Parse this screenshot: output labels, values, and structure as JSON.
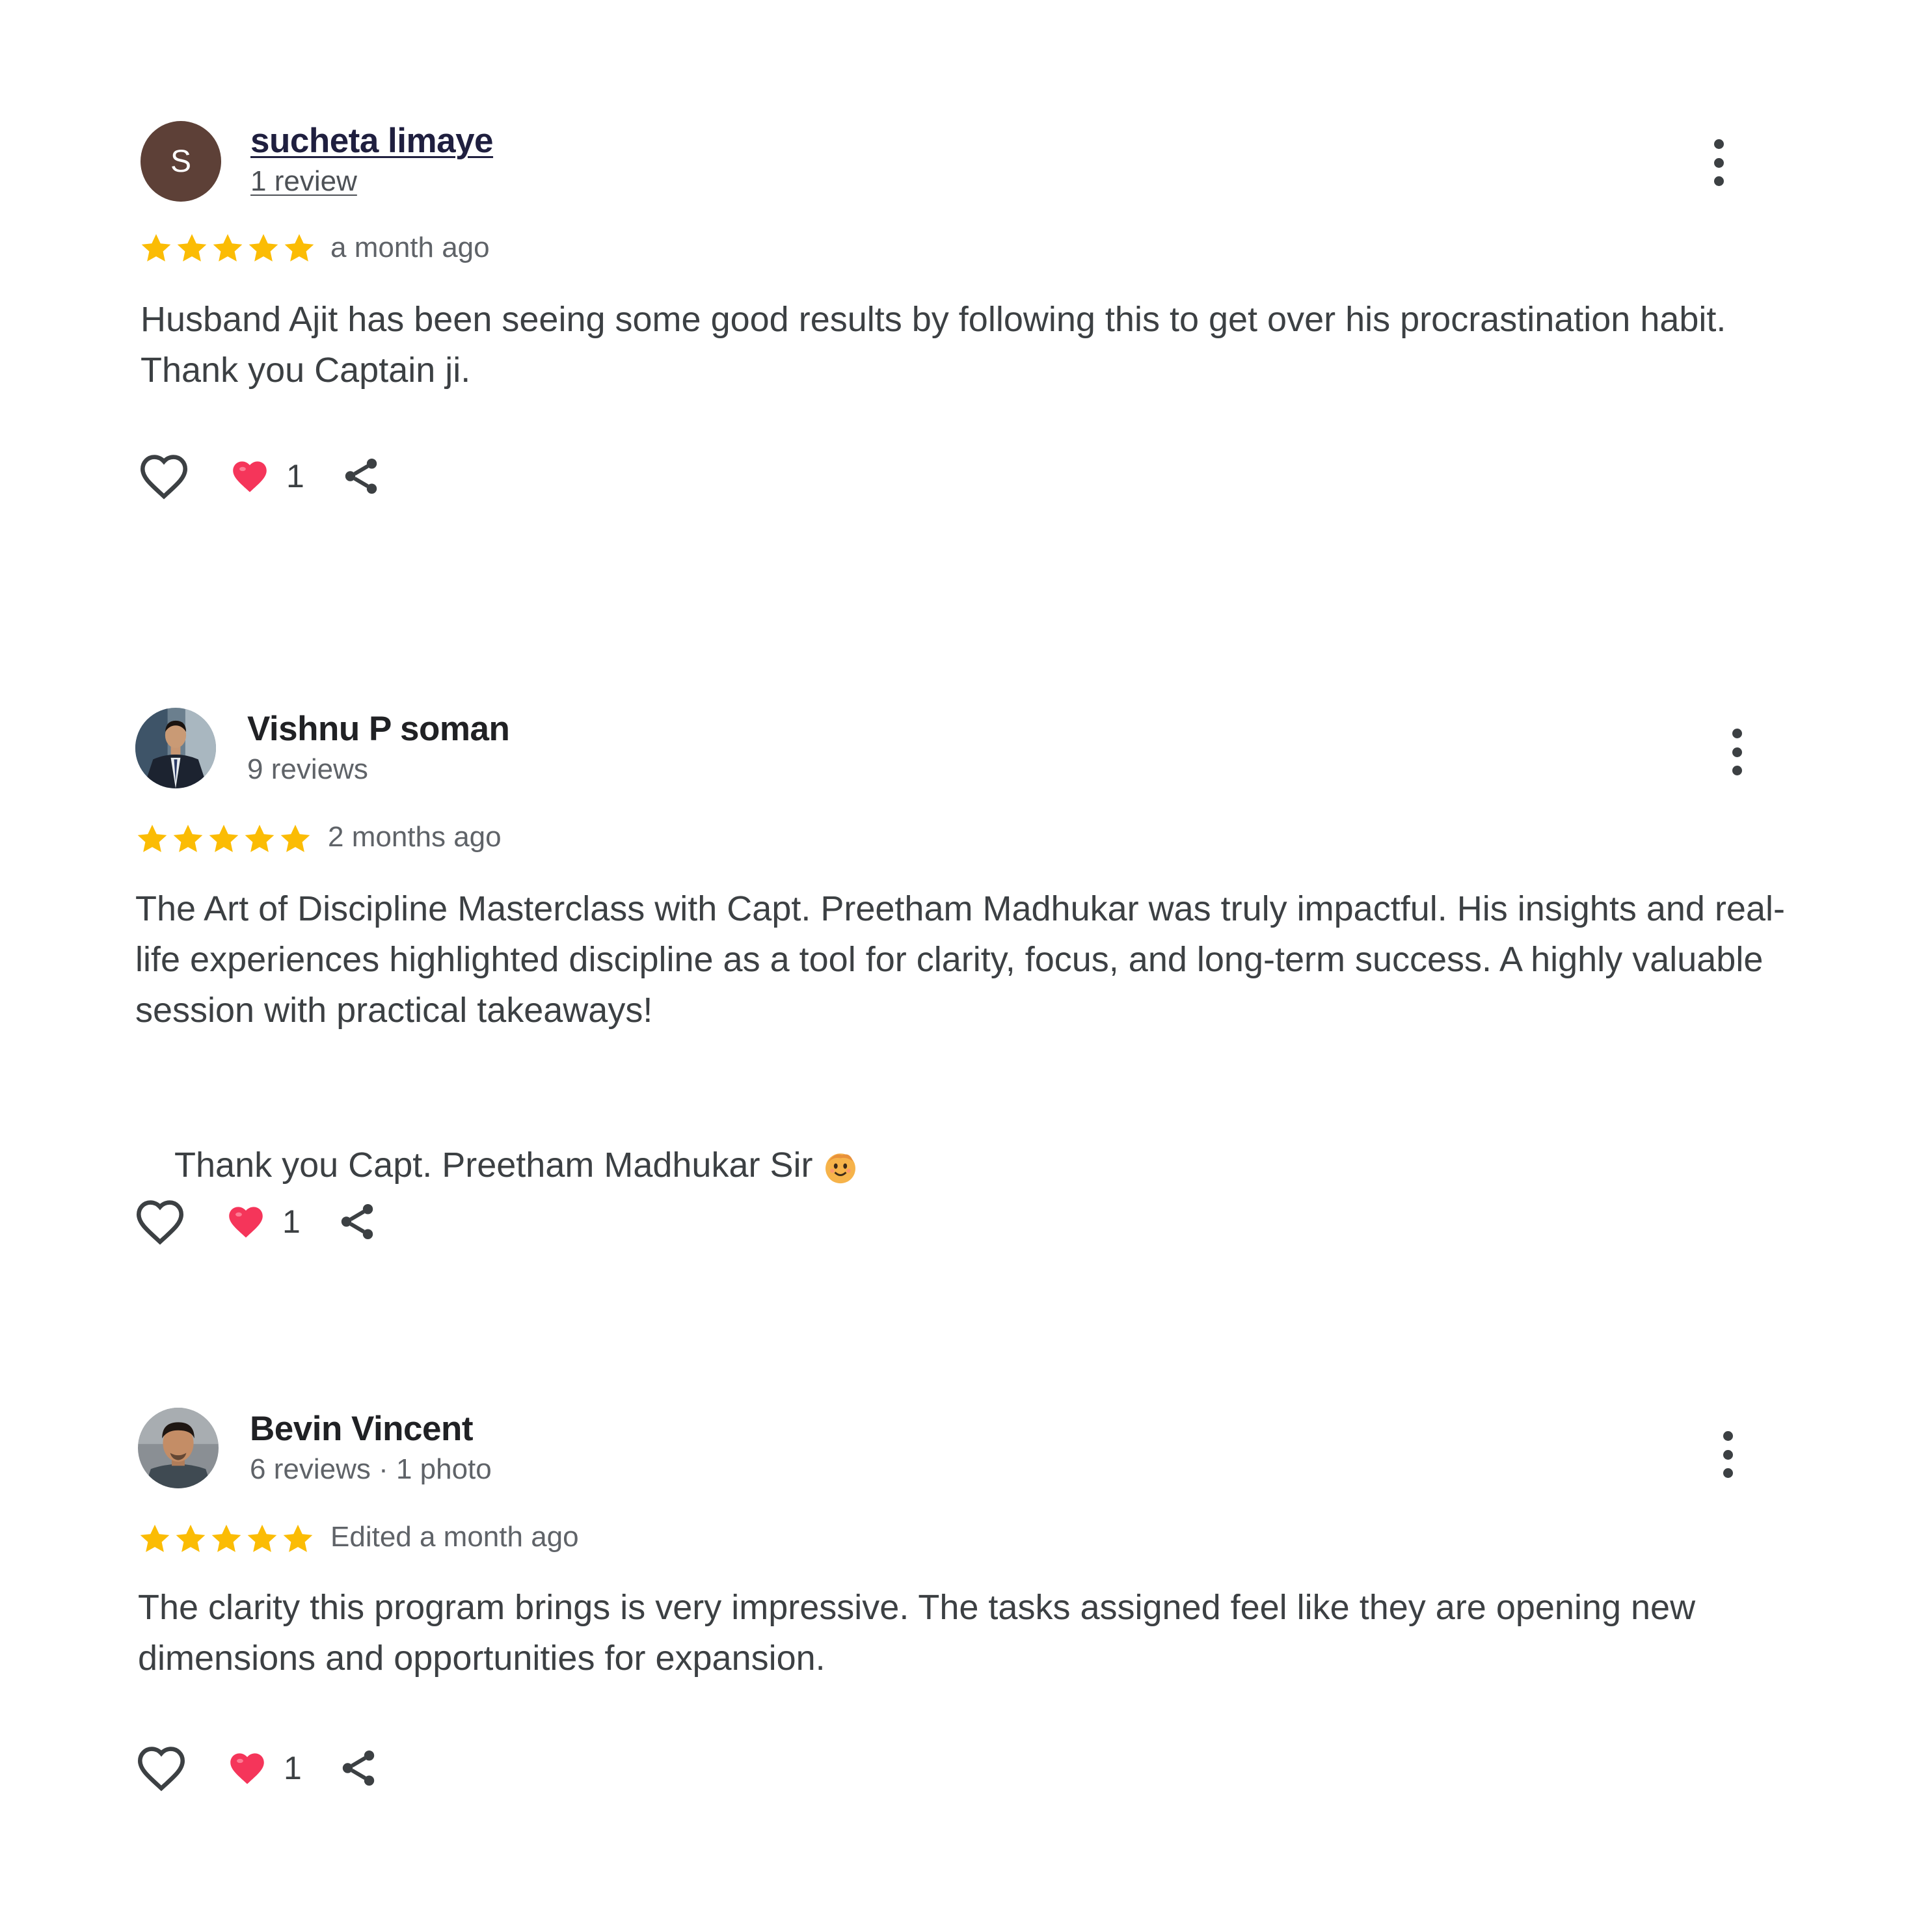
{
  "colors": {
    "star": "#fbbc04",
    "heart_filled": "#f5355a",
    "avatar_letter_bg": "#5d4037",
    "text": "#3c4043",
    "meta": "#5f6368"
  },
  "reviews": [
    {
      "avatar_letter": "S",
      "name": "sucheta limaye",
      "meta": "1 review",
      "rating": 5,
      "time": "a month ago",
      "text": "Husband Ajit has been seeing some good results by following this to get over his procrastination habit. Thank you Captain ji.",
      "reaction_count": "1"
    },
    {
      "name": "Vishnu P soman",
      "meta": "9 reviews",
      "rating": 5,
      "time": "2 months ago",
      "text": "The Art of Discipline Masterclass with Capt. Preetham Madhukar was truly impactful. His insights and real-life experiences highlighted discipline as a tool for clarity, focus, and long-term success. A highly valuable session with practical takeaways!",
      "text2": "Thank you Capt. Preetham Madhukar Sir",
      "reaction_count": "1"
    },
    {
      "name": "Bevin Vincent",
      "meta": "6 reviews · 1 photo",
      "rating": 5,
      "time": "Edited a month ago",
      "text": "The clarity this program brings is very impressive. The tasks assigned feel like they are opening new dimensions and opportunities for expansion.",
      "reaction_count": "1"
    }
  ]
}
